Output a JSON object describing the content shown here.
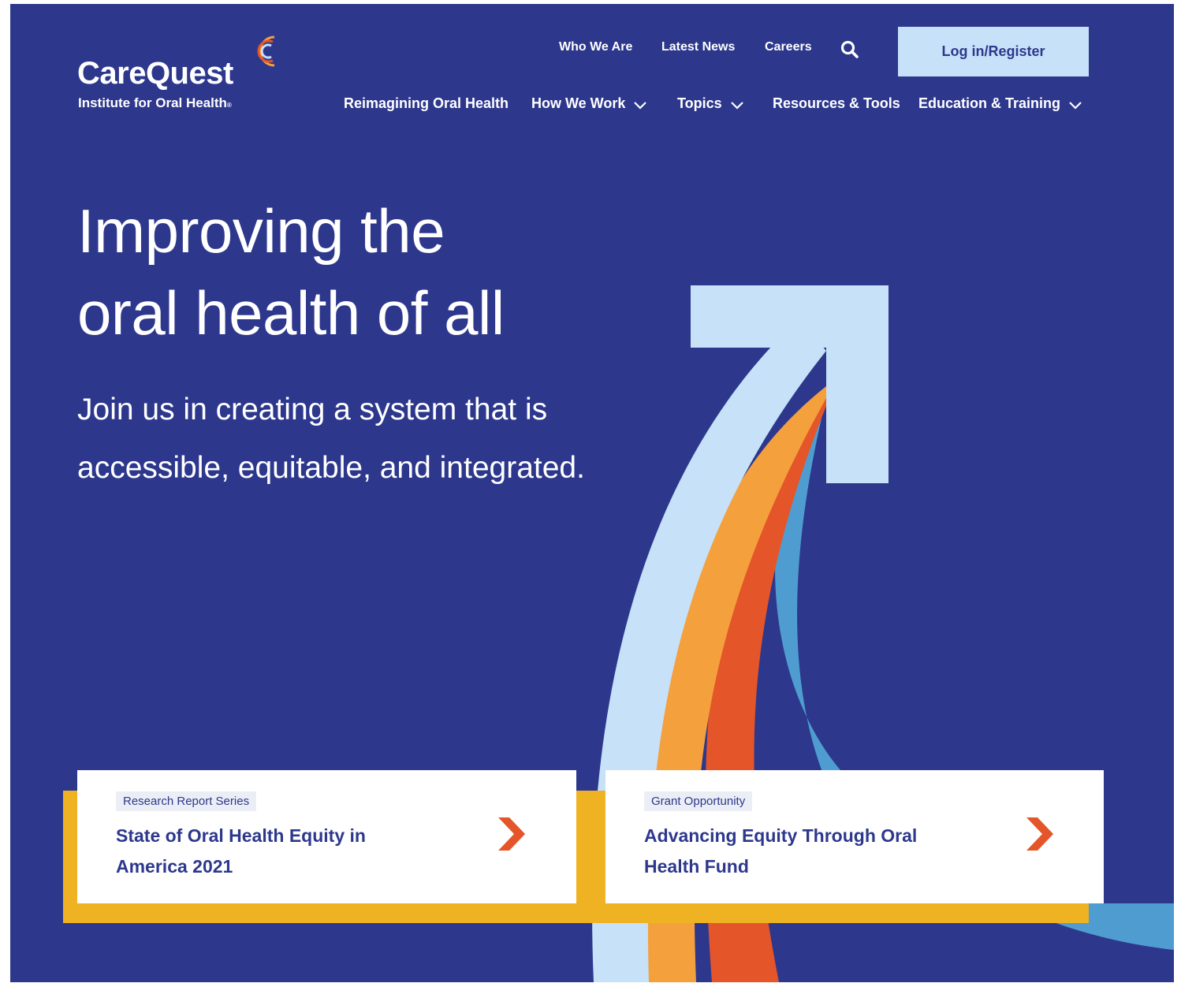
{
  "brand": {
    "name": "CareQuest",
    "tagline": "Institute for Oral Health",
    "trademark": "®",
    "colors": {
      "background": "#2d388d",
      "light_blue": "#c6e1f8",
      "orange": "#f4a03d",
      "red_orange": "#e4552a",
      "mid_blue": "#4f9dd0",
      "gold": "#efb223"
    }
  },
  "utility_nav": {
    "links": [
      "Who We Are",
      "Latest News",
      "Careers"
    ],
    "search_icon": "search-icon",
    "login_label": "Log in/Register"
  },
  "main_nav": {
    "items": [
      {
        "label": "Reimagining Oral Health",
        "has_dropdown": false
      },
      {
        "label": "How We Work",
        "has_dropdown": true
      },
      {
        "label": "Topics",
        "has_dropdown": true
      },
      {
        "label": "Resources & Tools",
        "has_dropdown": false
      },
      {
        "label": "Education & Training",
        "has_dropdown": true
      }
    ]
  },
  "hero": {
    "title_line1": "Improving the",
    "title_line2": "oral health of all",
    "subtitle": "Join us in creating a system that is accessible, equitable, and integrated."
  },
  "cards": [
    {
      "tag": "Research Report Series",
      "title": "State of Oral Health Equity in America 2021",
      "arrow_icon": "chevron-right-icon"
    },
    {
      "tag": "Grant Opportunity",
      "title": "Advancing Equity Through Oral Health Fund",
      "arrow_icon": "chevron-right-icon"
    }
  ]
}
